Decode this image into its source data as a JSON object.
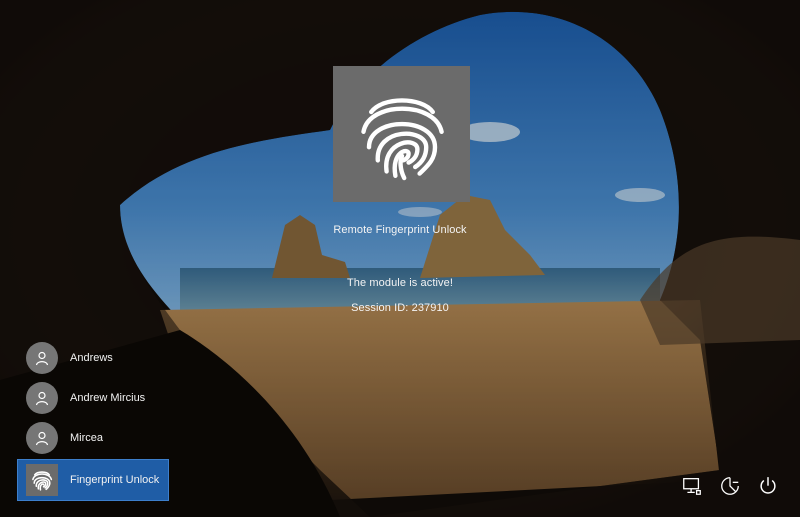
{
  "credential_tile": {
    "name": "Remote Fingerprint Unlock",
    "status": "The module is active!",
    "session": "Session ID: 237910",
    "icon": "fingerprint-icon"
  },
  "users": [
    {
      "name": "Andrews",
      "icon": "user-icon",
      "selected": false
    },
    {
      "name": "Andrew Mircius",
      "icon": "user-icon",
      "selected": false
    },
    {
      "name": "Mircea",
      "icon": "user-icon",
      "selected": false
    },
    {
      "name": "Fingerprint Unlock",
      "icon": "fingerprint-icon",
      "selected": true
    }
  ],
  "system_icons": [
    "network-icon",
    "ease-of-access-icon",
    "power-icon"
  ],
  "colors": {
    "selected_user_bg": "#1f5da6",
    "tile_bg": "#6b6b6b",
    "avatar_bg": "#767676"
  }
}
